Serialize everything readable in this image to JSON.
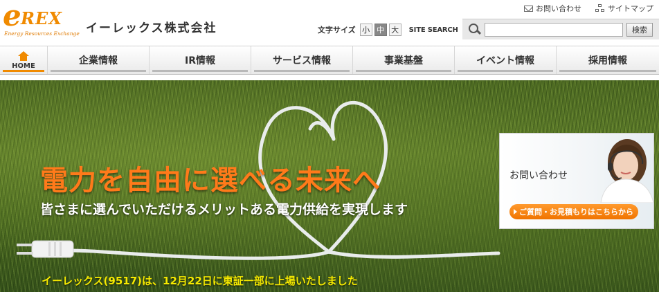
{
  "header": {
    "logo_text_e": "e",
    "logo_text_rex": "REX",
    "logo_subtitle": "Energy Resources Exchange",
    "company_name": "イーレックス株式会社",
    "util_links": [
      {
        "label": "お問い合わせ",
        "icon": "mail-icon"
      },
      {
        "label": "サイトマップ",
        "icon": "sitemap-icon"
      }
    ],
    "font_size_label": "文字サイズ",
    "font_sizes": [
      "小",
      "中",
      "大"
    ],
    "font_size_selected": "中",
    "search_label": "SITE SEARCH",
    "search_value": "",
    "search_button": "検索"
  },
  "nav": {
    "home_label": "HOME",
    "items": [
      "企業情報",
      "IR情報",
      "サービス情報",
      "事業基盤",
      "イベント情報",
      "採用情報"
    ]
  },
  "hero": {
    "title": "電力を自由に選べる未来へ",
    "subtitle": "皆さまに選んでいただけるメリットある電力供給を実現します",
    "news": "イーレックス(9517)は、12月22日に東証一部に上場いたしました"
  },
  "contact": {
    "title": "お問い合わせ",
    "button": "ご質問・お見積もりはこちらから"
  },
  "colors": {
    "brand_orange": "#f08a00",
    "hero_title": "#ff7a1a",
    "news_yellow": "#f6ea00"
  }
}
